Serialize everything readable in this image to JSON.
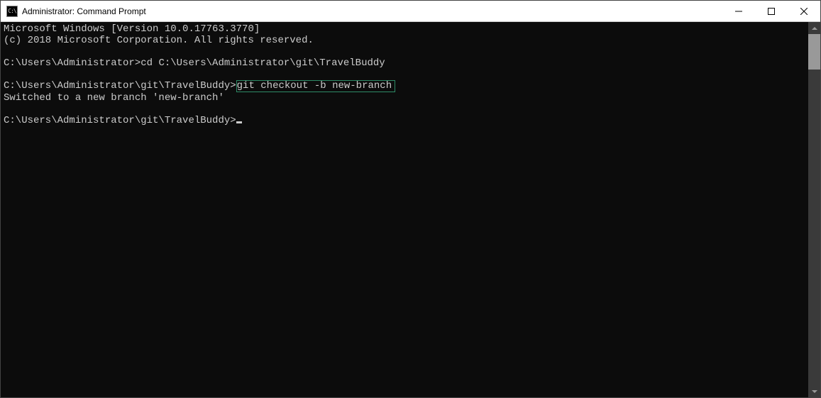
{
  "titlebar": {
    "icon_text": "C:\\",
    "title": "Administrator: Command Prompt"
  },
  "terminal": {
    "line1": "Microsoft Windows [Version 10.0.17763.3770]",
    "line2": "(c) 2018 Microsoft Corporation. All rights reserved.",
    "blank1": "",
    "prompt1": "C:\\Users\\Administrator>",
    "cmd1": "cd C:\\Users\\Administrator\\git\\TravelBuddy",
    "blank2": "",
    "prompt2": "C:\\Users\\Administrator\\git\\TravelBuddy>",
    "cmd2": "git checkout -b new-branch",
    "output1": "Switched to a new branch 'new-branch'",
    "blank3": "",
    "prompt3": "C:\\Users\\Administrator\\git\\TravelBuddy>"
  }
}
